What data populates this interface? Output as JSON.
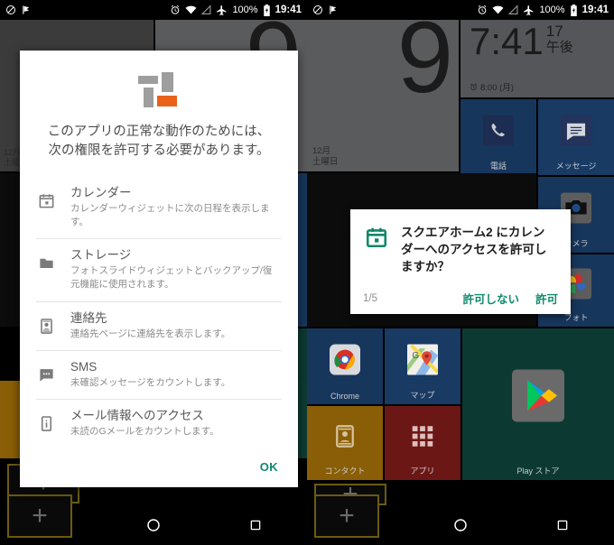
{
  "status_bar": {
    "left_icons": [
      "rotation-lock-icon",
      "flag-icon"
    ],
    "right_icons": [
      "alarm-icon",
      "wifi-icon",
      "signal-icon",
      "airplane-icon"
    ],
    "battery_percent": "100%",
    "time": "19:41"
  },
  "widgets": {
    "clock": {
      "time": "7:41",
      "seconds": "17",
      "ampm": "午後",
      "alarm": "8:00 (月)"
    },
    "calendar": {
      "day": "9",
      "month": "12月",
      "weekday": "土曜日"
    }
  },
  "tiles": [
    {
      "label": "電話",
      "icon": "phone-icon"
    },
    {
      "label": "メッセージ",
      "icon": "message-icon"
    },
    {
      "label": "カメラ",
      "icon": "camera-icon"
    },
    {
      "label": "フォト",
      "icon": "photos-icon"
    },
    {
      "label": "Chrome",
      "icon": "chrome-icon"
    },
    {
      "label": "マップ",
      "icon": "maps-icon"
    },
    {
      "label": "コンタクト",
      "icon": "contacts-icon"
    },
    {
      "label": "アプリ",
      "icon": "apps-grid-icon"
    },
    {
      "label": "Play ストア",
      "icon": "play-store-icon"
    }
  ],
  "nav_bar": {
    "back": "back-triangle-icon",
    "home": "home-circle-icon",
    "recents": "recents-square-icon",
    "add": "+"
  },
  "rationale_dialog": {
    "logo": "square-home-logo",
    "intro_line1": "このアプリの正常な動作のためには、",
    "intro_line2": "次の権限を許可する必要があります。",
    "permissions": [
      {
        "icon": "calendar-icon",
        "title": "カレンダー",
        "desc": "カレンダーウィジェットに次の日程を表示します。"
      },
      {
        "icon": "folder-icon",
        "title": "ストレージ",
        "desc": "フォトスライドウィジェットとバックアップ/復元機能に使用されます。"
      },
      {
        "icon": "contact-card-icon",
        "title": "連絡先",
        "desc": "連絡先ページに連絡先を表示します。"
      },
      {
        "icon": "sms-icon",
        "title": "SMS",
        "desc": "未確認メッセージをカウントします。"
      },
      {
        "icon": "info-phone-icon",
        "title": "メール情報へのアクセス",
        "desc": "未読のGメールをカウントします。"
      }
    ],
    "ok_label": "OK"
  },
  "permission_dialog": {
    "icon": "calendar-icon",
    "message": "スクエアホーム2 にカレンダーへのアクセスを許可しますか？",
    "app_name": "スクエアホーム2",
    "counter": "1/5",
    "deny_label": "許可しない",
    "allow_label": "許可"
  },
  "colors": {
    "accent_green": "#0f8a6e",
    "logo_orange": "#e8621a",
    "logo_gray": "#9e9e9e",
    "tile_blue": "#17365c",
    "tile_green": "#0c3a33",
    "tile_amber": "#8a5e06",
    "tile_red": "#6b1716"
  }
}
